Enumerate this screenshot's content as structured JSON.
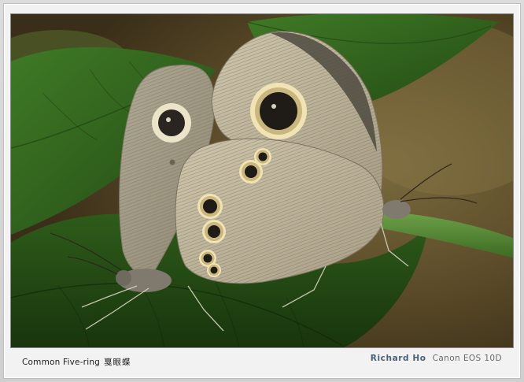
{
  "caption": {
    "species_name": "Common Five-ring",
    "chinese_name": "戛眼蝶"
  },
  "credit": {
    "author": "Richard Ho",
    "camera": "Canon EOS 10D"
  },
  "colors": {
    "frame": "#d4d4d4",
    "mat": "#f2f2f2",
    "author_text": "#4a5f7a",
    "camera_text": "#6b6b6b",
    "leaf_green": "#2f5a1c",
    "background_brown": "#4a3a22"
  }
}
